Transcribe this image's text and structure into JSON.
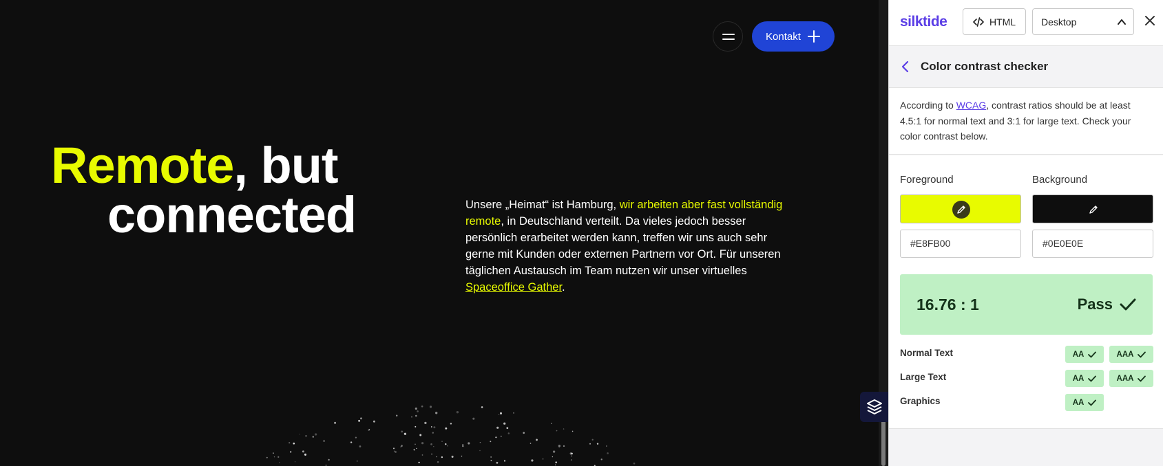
{
  "site": {
    "contact_label": "Kontakt",
    "headline_highlight": "Remote",
    "headline_rest": ", but",
    "headline_line2": "connected",
    "paragraph": {
      "part1": "Unsere „Heimat“ ist Hamburg, ",
      "highlight": "wir arbeiten aber fast vollständig remote",
      "part2": ", in Deutschland verteilt. Da vieles jedoch besser persönlich erarbeitet werden kann, treffen wir uns auch sehr gerne mit Kunden oder externen Partnern vor Ort. Für unseren täglichen Austausch im Team nutzen wir unser virtuelles ",
      "link": "Spaceoffice Gather",
      "part3": "."
    },
    "colors": {
      "accent": "#E8FB00",
      "background": "#0E0E0E",
      "button": "#2044D6"
    }
  },
  "panel": {
    "logo": "silktide",
    "html_button": "HTML",
    "device_select": "Desktop",
    "title": "Color contrast checker",
    "intro": {
      "before_link": "According to ",
      "link": "WCAG",
      "after_link": ", contrast ratios should be at least 4.5:1 for normal text and 3:1 for large text. Check your color contrast below."
    },
    "foreground_label": "Foreground",
    "background_label": "Background",
    "foreground_hex": "#E8FB00",
    "background_hex": "#0E0E0E",
    "ratio": "16.76 : 1",
    "result": "Pass",
    "rows": [
      {
        "label": "Normal Text",
        "aa": "AA",
        "aaa": "AAA"
      },
      {
        "label": "Large Text",
        "aa": "AA",
        "aaa": "AAA"
      },
      {
        "label": "Graphics",
        "aa": "AA"
      }
    ],
    "colors": {
      "brand": "#5B3EE6",
      "pass_bg": "#BFF0C4",
      "pass_text": "#15331A"
    }
  }
}
